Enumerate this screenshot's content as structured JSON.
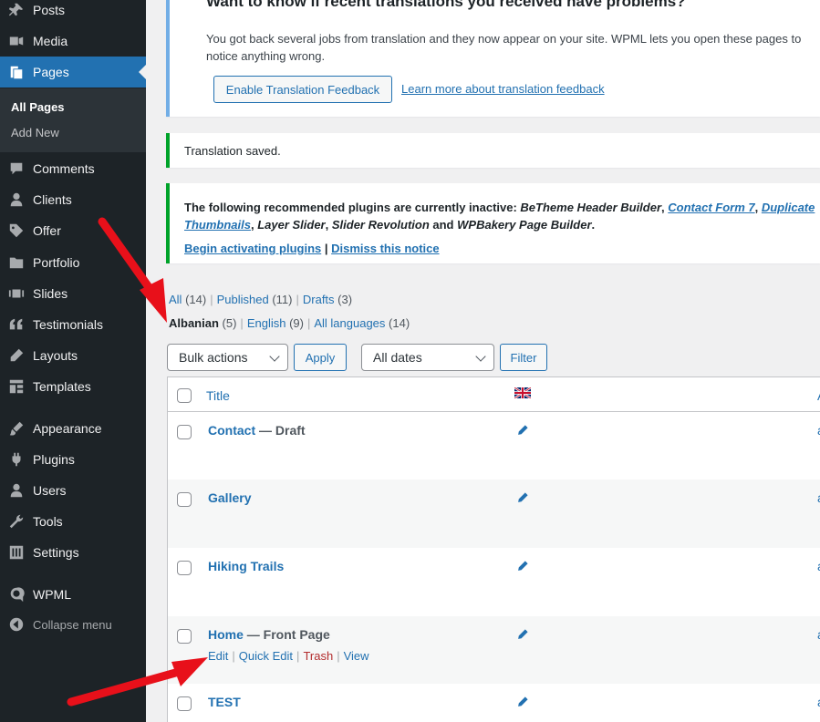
{
  "sidebar": {
    "items": [
      {
        "label": "Posts",
        "icon": "pin-icon"
      },
      {
        "label": "Media",
        "icon": "media-icon"
      },
      {
        "label": "Pages",
        "icon": "pages-icon"
      },
      {
        "label": "Comments",
        "icon": "comments-icon"
      },
      {
        "label": "Clients",
        "icon": "user-icon"
      },
      {
        "label": "Offer",
        "icon": "tag-icon"
      },
      {
        "label": "Portfolio",
        "icon": "folder-icon"
      },
      {
        "label": "Slides",
        "icon": "slides-icon"
      },
      {
        "label": "Testimonials",
        "icon": "quote-icon"
      },
      {
        "label": "Layouts",
        "icon": "pencil-icon"
      },
      {
        "label": "Templates",
        "icon": "grid-icon"
      },
      {
        "label": "Appearance",
        "icon": "brush-icon"
      },
      {
        "label": "Plugins",
        "icon": "plug-icon"
      },
      {
        "label": "Users",
        "icon": "user-icon"
      },
      {
        "label": "Tools",
        "icon": "wrench-icon"
      },
      {
        "label": "Settings",
        "icon": "sliders-icon"
      },
      {
        "label": "WPML",
        "icon": "wpml-icon"
      },
      {
        "label": "Collapse menu",
        "icon": "collapse-icon"
      }
    ],
    "submenu": {
      "all_pages": "All Pages",
      "add_new": "Add New"
    }
  },
  "notices": {
    "feedback": {
      "title": "Want to know if recent translations you received have problems?",
      "message": "You got back several jobs from translation and they now appear on your site. WPML lets you open these pages to notice anything wrong.",
      "button": "Enable Translation Feedback",
      "link": "Learn more about translation feedback"
    },
    "saved": "Translation saved.",
    "plugins": {
      "prefix": "The following recommended plugins are currently inactive:",
      "p1": "BeTheme Header Builder",
      "p2": "Contact Form 7",
      "p3": "Duplicate",
      "p4": "Thumbnails",
      "p5": "Layer Slider",
      "p6": "Slider Revolution",
      "and": "and",
      "p7": "WPBakery Page Builder",
      "begin": "Begin activating plugins",
      "dismiss": "Dismiss this notice"
    }
  },
  "status_filter": {
    "all": "All",
    "all_count": "(14)",
    "published": "Published",
    "published_count": "(11)",
    "drafts": "Drafts",
    "drafts_count": "(3)"
  },
  "lang_filter": {
    "albanian": "Albanian",
    "albanian_count": "(5)",
    "english": "English",
    "english_count": "(9)",
    "all": "All languages",
    "all_count": "(14)"
  },
  "toolbar": {
    "bulk": "Bulk actions",
    "apply": "Apply",
    "dates": "All dates",
    "filter": "Filter"
  },
  "table": {
    "header_title": "Title",
    "header_edge": "A",
    "rows": [
      {
        "title": "Contact",
        "state": " — Draft",
        "edge": "a"
      },
      {
        "title": "Gallery",
        "state": "",
        "edge": "a"
      },
      {
        "title": "Hiking Trails",
        "state": "",
        "edge": "a"
      },
      {
        "title": "Home",
        "state": " — Front Page",
        "edge": "a"
      },
      {
        "title": "TEST",
        "state": "",
        "edge": "a"
      }
    ],
    "row_actions": {
      "edit": "Edit",
      "quick_edit": "Quick Edit",
      "trash": "Trash",
      "view": "View"
    }
  },
  "colors": {
    "sidebar_bg": "#1d2327",
    "accent": "#2271b1",
    "success": "#00a32a",
    "info": "#72aee6",
    "danger": "#b32d2e",
    "annotation_arrow": "#e8101a"
  }
}
